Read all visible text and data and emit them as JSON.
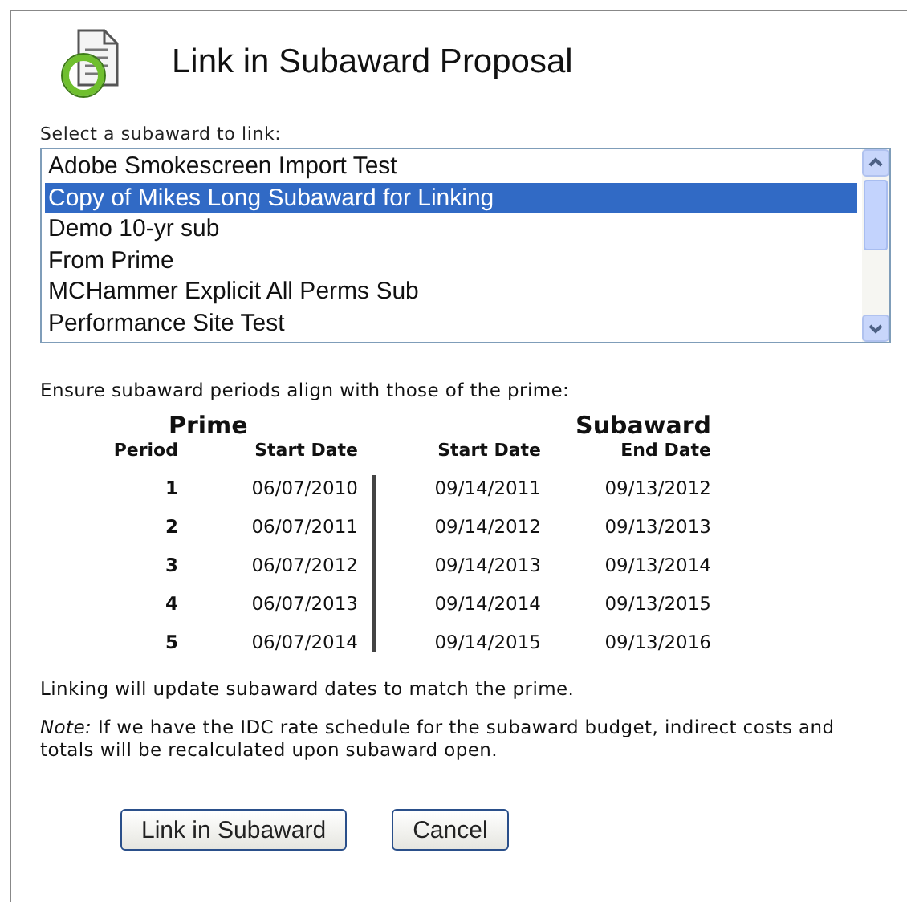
{
  "dialog": {
    "title": "Link in Subaward Proposal"
  },
  "list_label": "Select a subaward to link:",
  "subawards": [
    {
      "label": "Adobe Smokescreen Import Test",
      "selected": false
    },
    {
      "label": "Copy of Mikes Long Subaward for Linking",
      "selected": true
    },
    {
      "label": "Demo 10-yr sub",
      "selected": false
    },
    {
      "label": "From Prime",
      "selected": false
    },
    {
      "label": "MCHammer Explicit All Perms Sub",
      "selected": false
    },
    {
      "label": "Performance Site Test",
      "selected": false
    }
  ],
  "instructions": "Ensure subaward periods align with those of the prime:",
  "periods_table": {
    "group_headers": [
      "Prime",
      "Subaward"
    ],
    "columns": [
      "Period",
      "Start Date",
      "Start Date",
      "End Date"
    ],
    "rows": [
      [
        "1",
        "06/07/2010",
        "09/14/2011",
        "09/13/2012"
      ],
      [
        "2",
        "06/07/2011",
        "09/14/2012",
        "09/13/2013"
      ],
      [
        "3",
        "06/07/2012",
        "09/14/2013",
        "09/13/2014"
      ],
      [
        "4",
        "06/07/2013",
        "09/14/2014",
        "09/13/2015"
      ],
      [
        "5",
        "06/07/2014",
        "09/14/2015",
        "09/13/2016"
      ]
    ]
  },
  "linking_note": "Linking will update subaward dates to match the prime.",
  "note": "*Note:* If we have the IDC rate schedule for the subaward budget, indirect costs and totals will be recalculated upon subaward open.",
  "buttons": [
    "Link in Subaward",
    "Cancel"
  ]
}
